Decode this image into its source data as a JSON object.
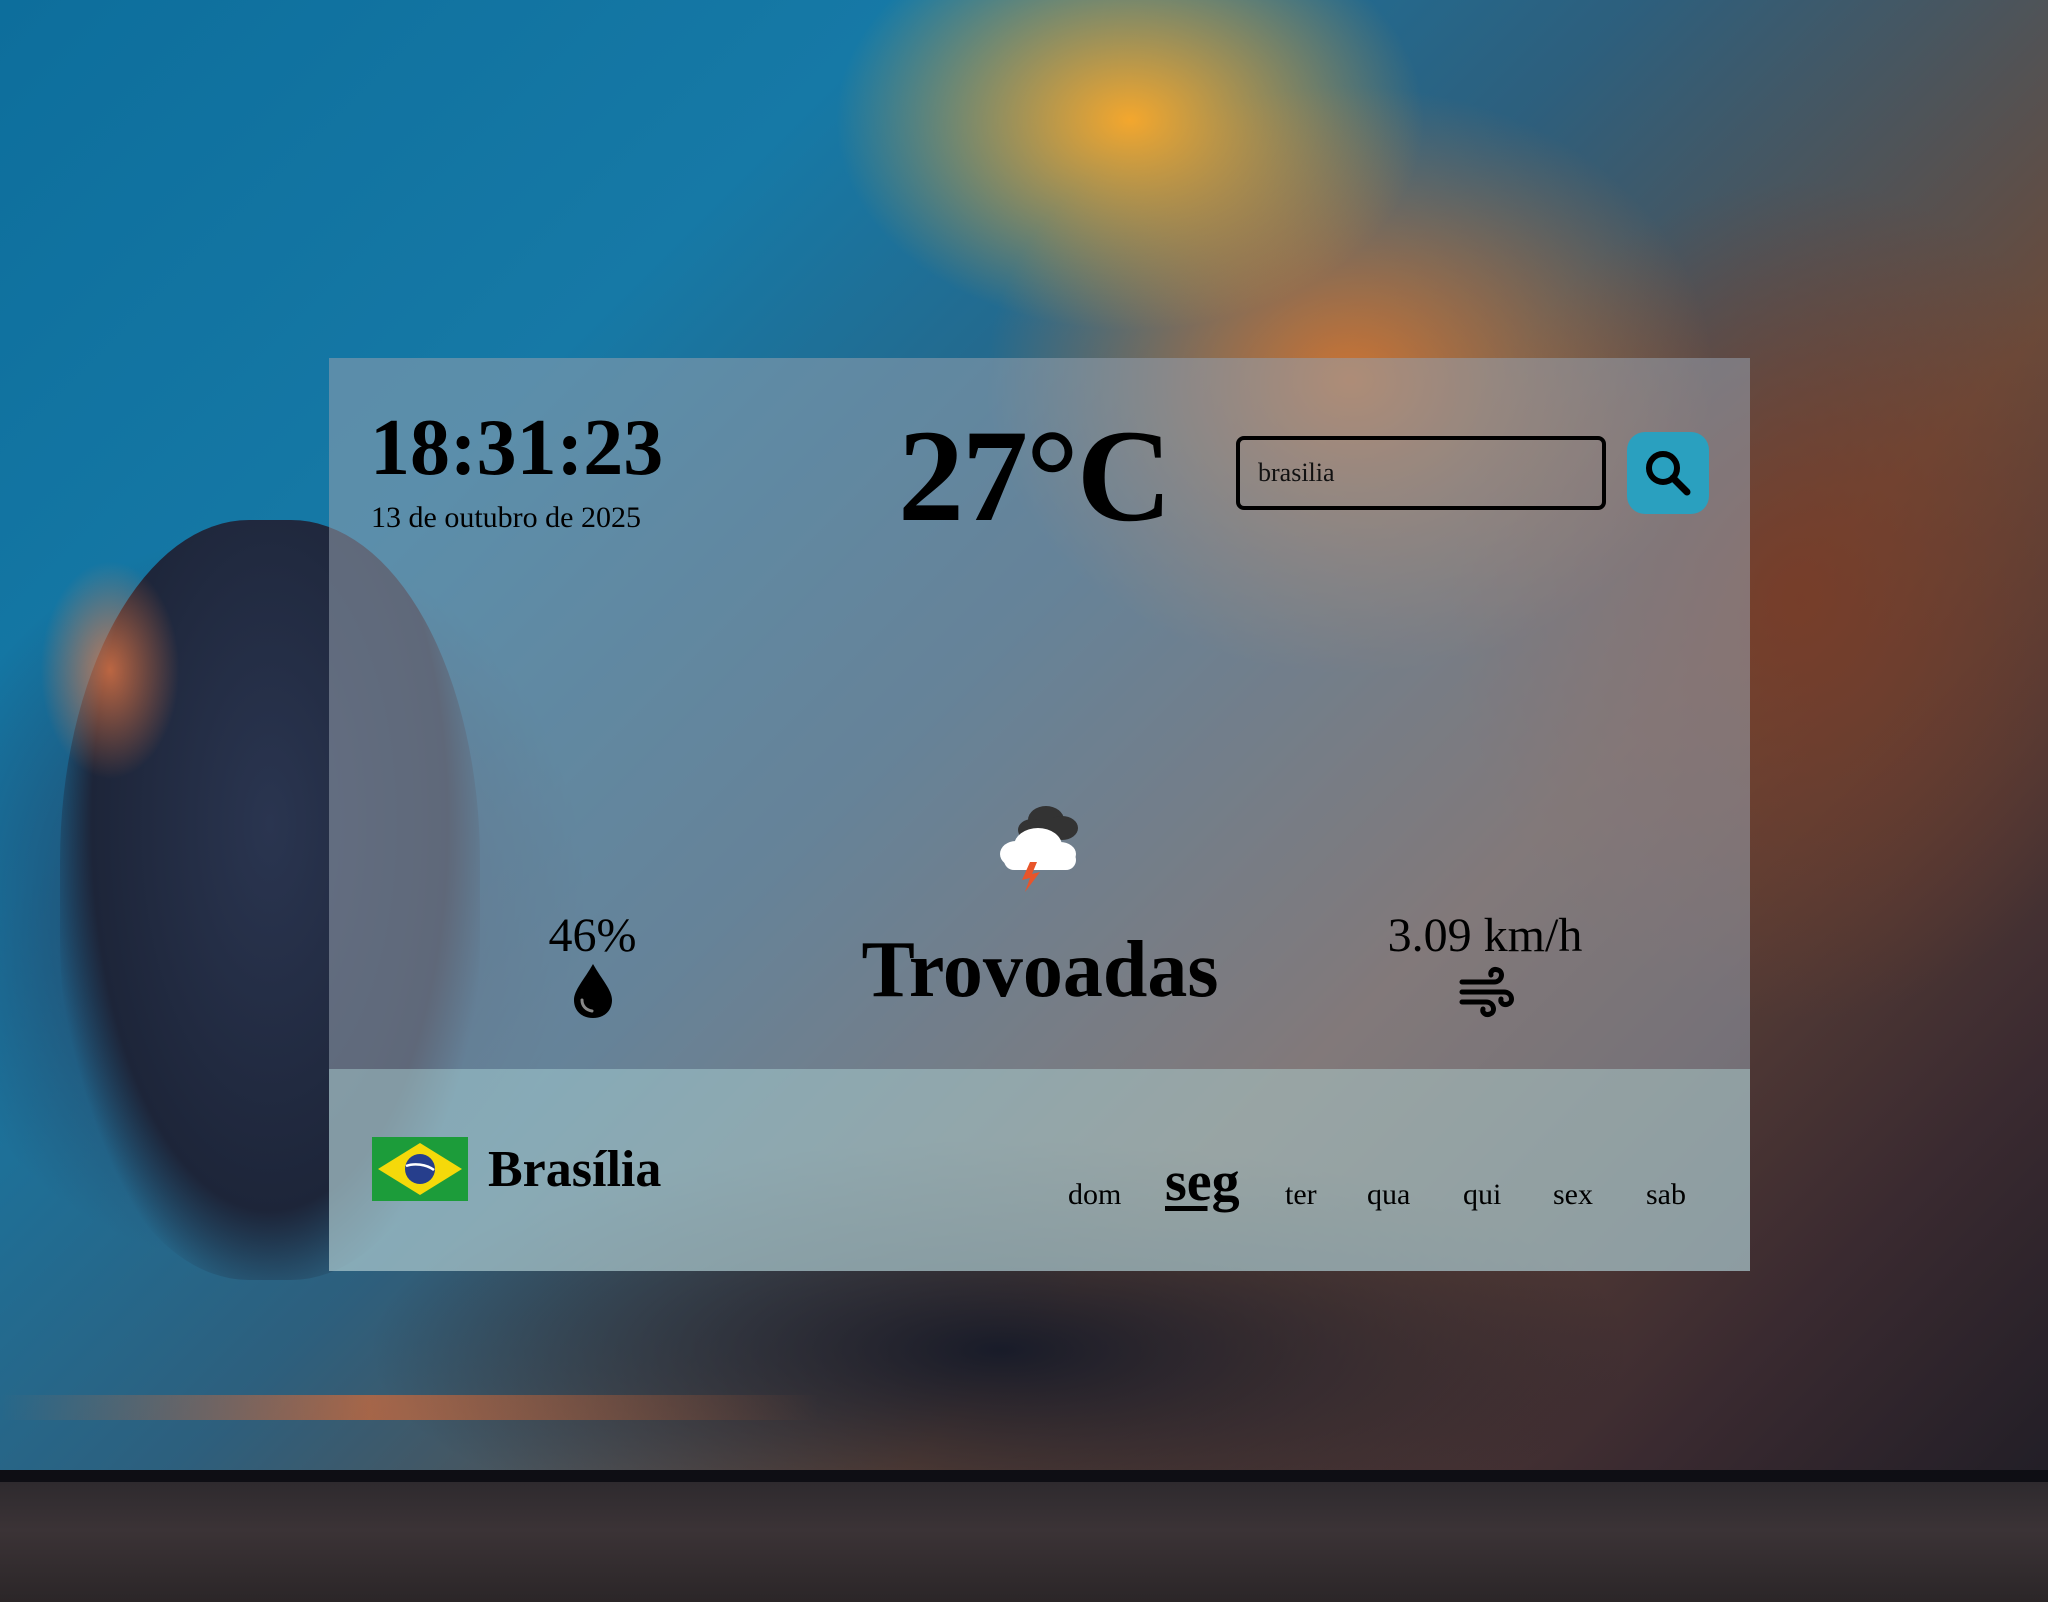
{
  "header": {
    "time": "18:31:23",
    "date": "13 de outubro de 2025",
    "temperature": "27°C"
  },
  "search": {
    "value": "brasilia",
    "button_icon": "search-icon"
  },
  "current": {
    "condition": "Trovoadas",
    "condition_icon": "thunderstorm-icon",
    "humidity": "46%",
    "humidity_icon": "water-drop-icon",
    "wind": "3.09 km/h",
    "wind_icon": "wind-icon"
  },
  "location": {
    "city": "Brasília",
    "flag_icon": "brazil-flag-icon"
  },
  "days": {
    "items": [
      "dom",
      "seg",
      "ter",
      "qua",
      "qui",
      "sex",
      "sab"
    ],
    "active": "seg"
  },
  "colors": {
    "accent": "#2aa0bf",
    "text": "#000000"
  }
}
